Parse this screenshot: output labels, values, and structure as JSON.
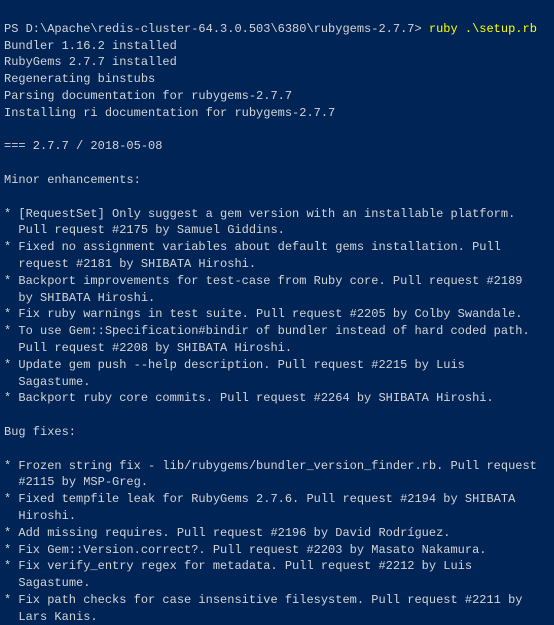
{
  "prompt": {
    "path": "PS D:\\Apache\\redis-cluster-64.3.0.503\\6380\\rubygems-2.7.7>",
    "command": "ruby .\\setup.rb"
  },
  "output": {
    "line1": "Bundler 1.16.2 installed",
    "line2": "RubyGems 2.7.7 installed",
    "line3": "Regenerating binstubs",
    "line4": "Parsing documentation for rubygems-2.7.7",
    "line5": "Installing ri documentation for rubygems-2.7.7",
    "line6": "",
    "line7": "=== 2.7.7 / 2018-05-08",
    "line8": "",
    "line9": "Minor enhancements:",
    "line10": "",
    "line11": "* [RequestSet] Only suggest a gem version with an installable platform.",
    "line12": "  Pull request #2175 by Samuel Giddins.",
    "line13": "* Fixed no assignment variables about default gems installation. Pull",
    "line14": "  request #2181 by SHIBATA Hiroshi.",
    "line15": "* Backport improvements for test-case from Ruby core. Pull request #2189",
    "line16": "  by SHIBATA Hiroshi.",
    "line17": "* Fix ruby warnings in test suite. Pull request #2205 by Colby Swandale.",
    "line18": "* To use Gem::Specification#bindir of bundler instead of hard coded path.",
    "line19": "  Pull request #2208 by SHIBATA Hiroshi.",
    "line20": "* Update gem push --help description. Pull request #2215 by Luis",
    "line21": "  Sagastume.",
    "line22": "* Backport ruby core commits. Pull request #2264 by SHIBATA Hiroshi.",
    "line23": "",
    "line24": "Bug fixes:",
    "line25": "",
    "line26": "* Frozen string fix - lib/rubygems/bundler_version_finder.rb. Pull request",
    "line27": "  #2115 by MSP-Greg.",
    "line28": "* Fixed tempfile leak for RubyGems 2.7.6. Pull request #2194 by SHIBATA",
    "line29": "  Hiroshi.",
    "line30": "* Add missing requires. Pull request #2196 by David Rodríguez.",
    "line31": "* Fix Gem::Version.correct?. Pull request #2203 by Masato Nakamura.",
    "line32": "* Fix verify_entry regex for metadata. Pull request #2212 by Luis",
    "line33": "  Sagastume.",
    "line34": "* Fix path checks for case insensitive filesystem. Pull request #2211 by",
    "line35": "  Lars Kanis."
  }
}
